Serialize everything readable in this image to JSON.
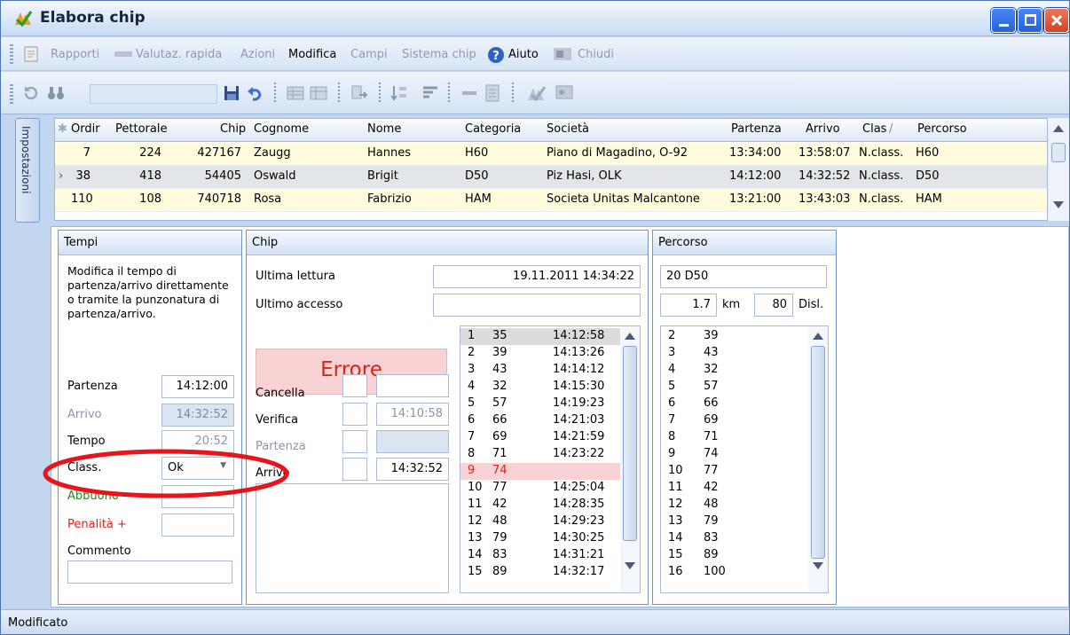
{
  "window": {
    "title": "Elabora chip"
  },
  "menu": [
    "Rapporti",
    "Valutaz. rapida",
    "Azioni",
    "Modifica",
    "Campi",
    "Sistema chip",
    "Aiuto",
    "Chiudi"
  ],
  "side_tab": "Impostazioni",
  "grid": {
    "columns": [
      "Ordir",
      "Pettorale",
      "Chip",
      "Cognome",
      "Nome",
      "Categoria",
      "Società",
      "Partenza",
      "Arrivo",
      "Clas",
      "Percorso"
    ],
    "rows": [
      [
        "7",
        "224",
        "427167",
        "Zaugg",
        "Hannes",
        "H60",
        "Piano di Magadino, O-92",
        "13:34:00",
        "13:58:07",
        "N.class.",
        "H60"
      ],
      [
        "38",
        "418",
        "54405",
        "Oswald",
        "Brigit",
        "D50",
        "Piz Hasi, OLK",
        "14:12:00",
        "14:32:52",
        "N.class.",
        "D50"
      ],
      [
        "110",
        "108",
        "740718",
        "Rosa",
        "Fabrizio",
        "HAM",
        "Societa Unitas Malcantone",
        "13:21:00",
        "13:43:03",
        "N.class.",
        "HAM"
      ]
    ]
  },
  "tempi": {
    "header": "Tempi",
    "desc": "Modifica il tempo di partenza/arrivo direttamente o tramite la punzonatura di partenza/arrivo.",
    "partenza_label": "Partenza",
    "partenza": "14:12:00",
    "arrivo_label": "Arrivo",
    "arrivo": "14:32:52",
    "tempo_label": "Tempo",
    "tempo": "20:52",
    "class_label": "Class.",
    "class": "Ok",
    "abbuono_label": "Abbuono -",
    "penalita_label": "Penalità +",
    "commento_label": "Commento"
  },
  "chip": {
    "header": "Chip",
    "ultima_lettura_label": "Ultima lettura",
    "ultima_lettura": "19.11.2011 14:34:22",
    "ultimo_accesso_label": "Ultimo accesso",
    "ultimo_accesso": "",
    "status": "Errore",
    "cancella_label": "Cancella",
    "verifica_label": "Verifica",
    "verifica": "14:10:58",
    "partenza_label": "Partenza",
    "arrivo_label": "Arrivo",
    "arrivo": "14:32:52",
    "punches": [
      [
        "1",
        "35",
        "14:12:58"
      ],
      [
        "2",
        "39",
        "14:13:26"
      ],
      [
        "3",
        "43",
        "14:14:12"
      ],
      [
        "4",
        "32",
        "14:15:30"
      ],
      [
        "5",
        "57",
        "14:19:23"
      ],
      [
        "6",
        "66",
        "14:21:03"
      ],
      [
        "7",
        "69",
        "14:21:59"
      ],
      [
        "8",
        "71",
        "14:23:22"
      ],
      [
        "9",
        "74",
        ""
      ],
      [
        "10",
        "77",
        "14:25:04"
      ],
      [
        "11",
        "42",
        "14:28:35"
      ],
      [
        "12",
        "48",
        "14:29:23"
      ],
      [
        "13",
        "79",
        "14:30:25"
      ],
      [
        "14",
        "83",
        "14:31:21"
      ],
      [
        "15",
        "89",
        "14:32:17"
      ]
    ]
  },
  "percorso": {
    "header": "Percorso",
    "name": "20 D50",
    "km": "1.7",
    "km_label": "km",
    "disl": "80",
    "disl_label": "Disl.",
    "controls": [
      [
        "2",
        "39"
      ],
      [
        "3",
        "43"
      ],
      [
        "4",
        "32"
      ],
      [
        "5",
        "57"
      ],
      [
        "6",
        "66"
      ],
      [
        "7",
        "69"
      ],
      [
        "8",
        "71"
      ],
      [
        "9",
        "74"
      ],
      [
        "10",
        "77"
      ],
      [
        "11",
        "42"
      ],
      [
        "12",
        "48"
      ],
      [
        "13",
        "79"
      ],
      [
        "14",
        "83"
      ],
      [
        "15",
        "89"
      ],
      [
        "16",
        "100"
      ]
    ]
  },
  "status": "Modificato",
  "colors": {
    "error_bg": "#f9d3d3",
    "error_text": "#e0211a",
    "row_alt": "#fffbdc",
    "annotation": "#e8141a"
  }
}
